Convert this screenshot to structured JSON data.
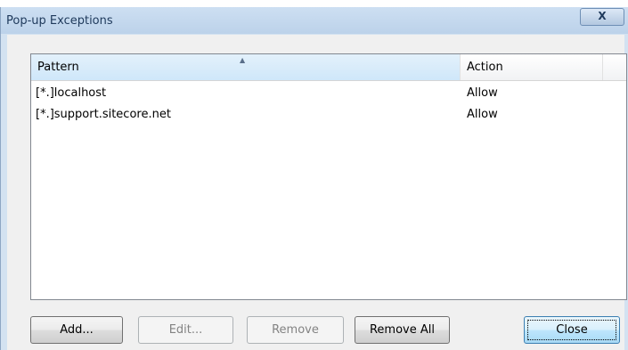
{
  "window": {
    "title": "Pop-up Exceptions",
    "close_glyph": "X"
  },
  "list": {
    "sort_glyph": "▲",
    "columns": [
      {
        "label": "Pattern",
        "sorted": "ascending"
      },
      {
        "label": "Action"
      }
    ],
    "rows": [
      {
        "pattern": "[*.]localhost",
        "action": "Allow"
      },
      {
        "pattern": "[*.]support.sitecore.net",
        "action": "Allow"
      }
    ]
  },
  "buttons": {
    "add": {
      "label": "Add...",
      "enabled": true
    },
    "edit": {
      "label": "Edit...",
      "enabled": false
    },
    "remove": {
      "label": "Remove",
      "enabled": false
    },
    "remove_all": {
      "label": "Remove All",
      "enabled": true
    },
    "close": {
      "label": "Close",
      "enabled": true,
      "default": true
    }
  },
  "colors": {
    "titlebar": "#c4d8ee",
    "client_bg": "#f0f0f0",
    "selected_header": "#cfe7fa",
    "default_button_border": "#3c7fb1"
  }
}
